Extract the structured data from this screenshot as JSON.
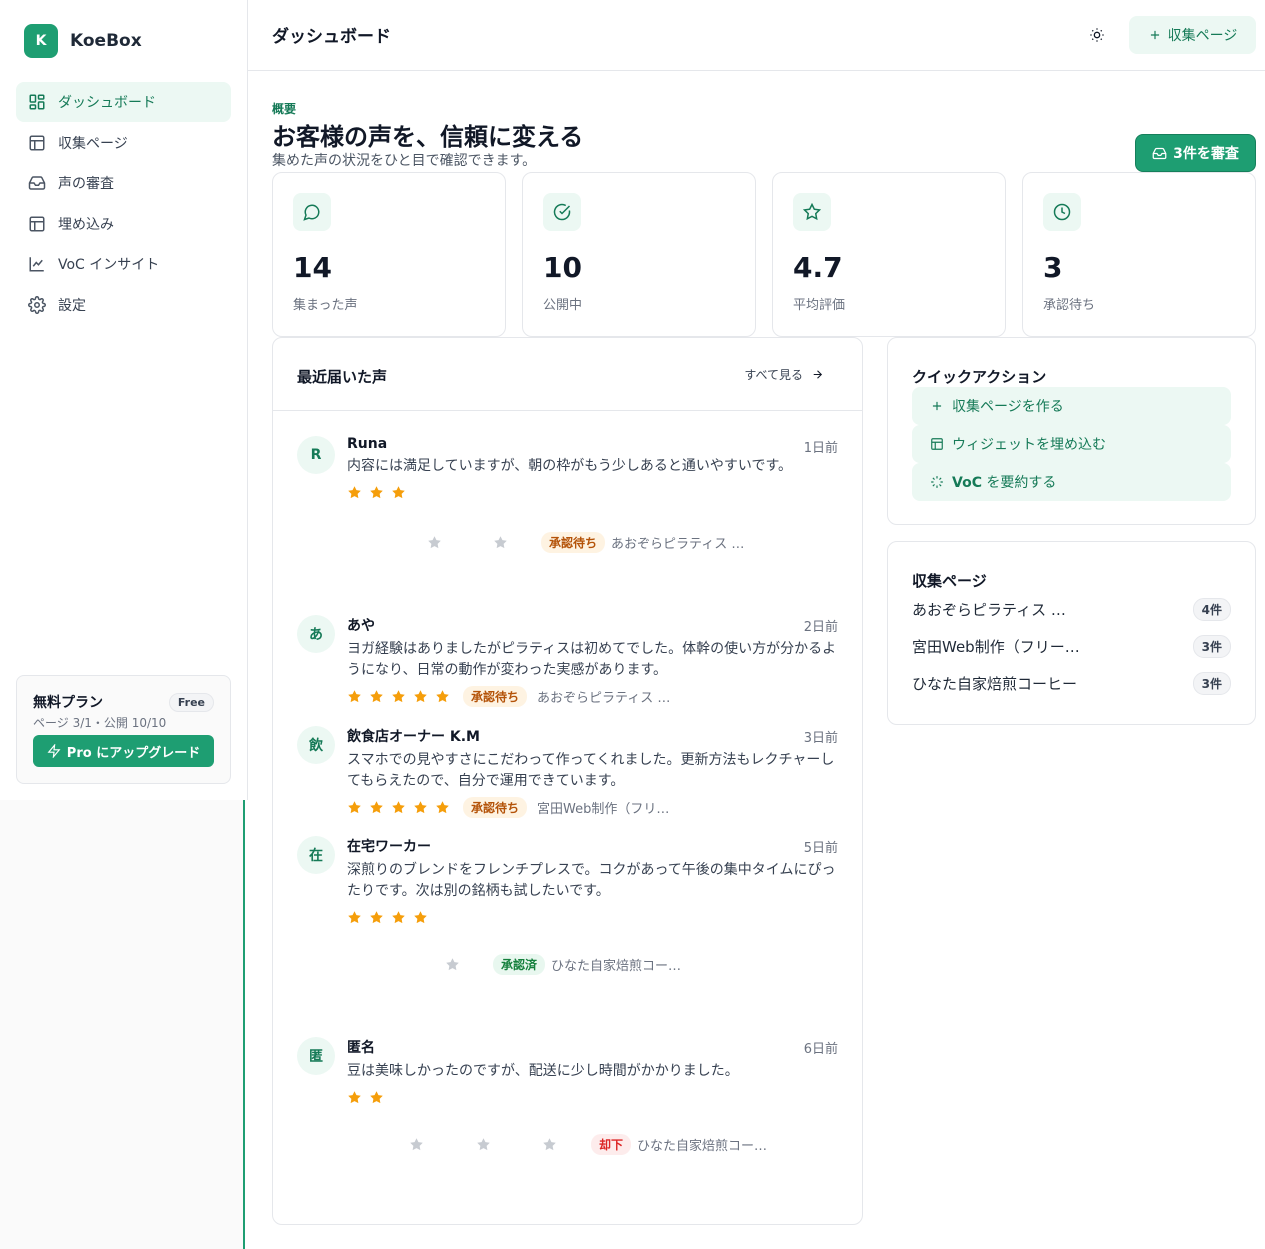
{
  "brand": {
    "logo": "K",
    "name": "KoeBox"
  },
  "sidebar": {
    "items": [
      {
        "label": "ダッシュボード",
        "icon": "dashboard-icon",
        "active": true
      },
      {
        "label": "収集ページ",
        "icon": "layout-icon"
      },
      {
        "label": "声の審査",
        "icon": "inbox-icon"
      },
      {
        "label": "埋め込み",
        "icon": "embed-icon"
      },
      {
        "label": "VoC インサイト",
        "icon": "chart-line-icon"
      },
      {
        "label": "設定",
        "icon": "gear-icon"
      }
    ],
    "plan": {
      "title": "無料プラン",
      "badge": "Free",
      "meta": "ページ 3/1・公開 10/10",
      "upgrade_label": "Pro にアップグレード"
    }
  },
  "topbar": {
    "title": "ダッシュボード",
    "collect_label": "収集ページ"
  },
  "hero": {
    "eyebrow": "概要",
    "headline": "お客様の声を、信頼に変える",
    "subline": "集めた声の状況をひと目で確認できます。",
    "review_label": "3件を審査"
  },
  "stats": [
    {
      "value": "14",
      "label": "集まった声",
      "icon": "message-icon"
    },
    {
      "value": "10",
      "label": "公開中",
      "icon": "check-circle-icon"
    },
    {
      "value": "4.7",
      "label": "平均評価",
      "icon": "star-icon"
    },
    {
      "value": "3",
      "label": "承認待ち",
      "icon": "clock-icon"
    }
  ],
  "recent": {
    "title": "最近届いた声",
    "see_all": "すべて見る",
    "reviews": [
      {
        "avatar": "R",
        "name": "Runa",
        "date": "1日前",
        "text": "内容には満足していますが、朝の枠がもう少しあると通いやすいです。",
        "rating": 3,
        "status": "承認待ち",
        "status_kind": "pending",
        "page": "あおぞらピラティス …"
      },
      {
        "avatar": "あ",
        "name": "あや",
        "date": "2日前",
        "text": "ヨガ経験はありましたがピラティスは初めてでした。体幹の使い方が分かるようになり、日常の動作が変わった実感があります。",
        "rating": 5,
        "status": "承認待ち",
        "status_kind": "pending",
        "page": "あおぞらピラティス …"
      },
      {
        "avatar": "飲",
        "name": "飲食店オーナー K.M",
        "date": "3日前",
        "text": "スマホでの見やすさにこだわって作ってくれました。更新方法もレクチャーしてもらえたので、自分で運用できています。",
        "rating": 5,
        "status": "承認待ち",
        "status_kind": "pending",
        "page": "宮田Web制作（フリ…"
      },
      {
        "avatar": "在",
        "name": "在宅ワーカー",
        "date": "5日前",
        "text": "深煎りのブレンドをフレンチプレスで。コクがあって午後の集中タイムにぴったりです。次は別の銘柄も試したいです。",
        "rating": 4,
        "status": "承認済",
        "status_kind": "approved",
        "page": "ひなた自家焙煎コー…"
      },
      {
        "avatar": "匿",
        "name": "匿名",
        "date": "6日前",
        "text": "豆は美味しかったのですが、配送に少し時間がかかりました。",
        "rating": 2,
        "status": "却下",
        "status_kind": "rejected",
        "page": "ひなた自家焙煎コー…"
      }
    ]
  },
  "quick": {
    "title": "クイックアクション",
    "actions": [
      {
        "label": "収集ページを作る",
        "icon": "plus-icon"
      },
      {
        "label": "ウィジェットを埋め込む",
        "icon": "layout-icon"
      },
      {
        "label_bold": "VoC",
        "label_rest": " を要約する",
        "icon": "sparkle-icon"
      }
    ]
  },
  "pages": {
    "title": "収集ページ",
    "rows": [
      {
        "name": "あおぞらピラティス …",
        "count": "4件"
      },
      {
        "name": "宮田Web制作（フリー…",
        "count": "3件"
      },
      {
        "name": "ひなた自家焙煎コーヒー",
        "count": "3件"
      }
    ]
  },
  "colors": {
    "accent": "#1e9e72",
    "accent_soft": "#ecf8f3",
    "star": "#f59e0b"
  }
}
